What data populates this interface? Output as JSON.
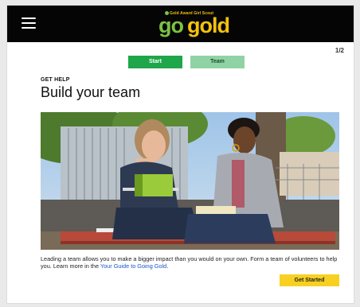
{
  "header": {
    "menu_icon": "hamburger-menu-icon",
    "logo_tagline": "Gold Award Girl Scout",
    "logo_go": "go",
    "logo_gold": "gold"
  },
  "progress": {
    "text": "1/2"
  },
  "steps": [
    {
      "label": "Start",
      "state": "active"
    },
    {
      "label": "Team",
      "state": "upcoming"
    }
  ],
  "content": {
    "eyebrow": "GET HELP",
    "title": "Build your team",
    "description": "Leading a team allows you to make a bigger impact than you would on your own. Form a team of volunteers to help you. Learn more in the ",
    "link_text": "Your Guide to Going Gold",
    "description_end": ".",
    "cta_label": "Get Started"
  },
  "colors": {
    "topbar": "#050505",
    "brand_green": "#7cc142",
    "brand_gold": "#f4c20d",
    "step_active": "#1fa64a",
    "step_inactive": "#8fd3a4",
    "cta": "#f8d021",
    "link": "#1a55c7"
  }
}
